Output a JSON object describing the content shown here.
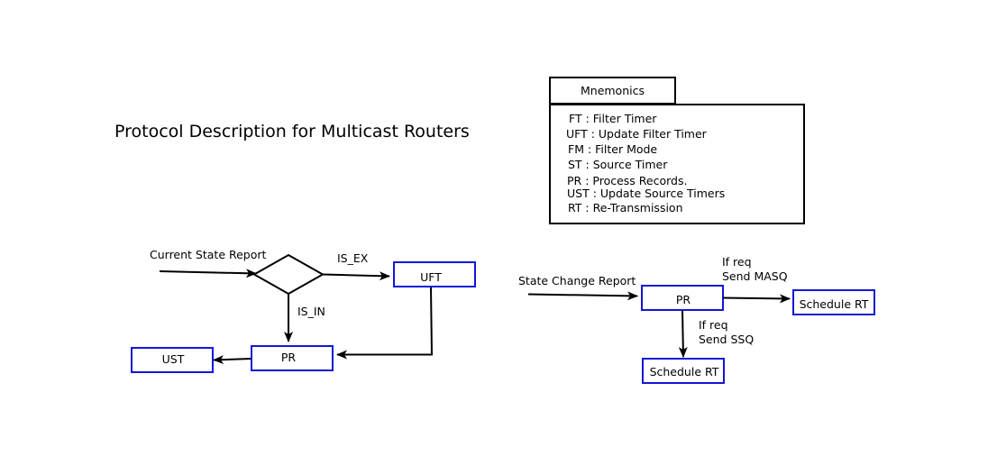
{
  "title": "Protocol Description for Multicast Routers",
  "mnemonics": {
    "header": "Mnemonics",
    "items": [
      "FT : Filter Timer",
      "UFT : Update Filter Timer",
      "FM : Filter Mode",
      "ST : Source Timer",
      "PR : Process Records.",
      "UST : Update Source Timers",
      "RT : Re-Transmission"
    ]
  },
  "current_state_flow": {
    "input_label": "Current State Report",
    "decision_exclude_label": "IS_EX",
    "decision_include_label": "IS_IN",
    "nodes": {
      "uft": "UFT",
      "pr": "PR",
      "ust": "UST"
    }
  },
  "state_change_flow": {
    "input_label": "State Change Report",
    "nodes": {
      "pr": "PR",
      "schedule_rt_right": "Schedule RT",
      "schedule_rt_bottom": "Schedule RT"
    },
    "masq_label_line1": "If req",
    "masq_label_line2": "Send MASQ",
    "ssq_label_line1": "If req",
    "ssq_label_line2": "Send SSQ"
  },
  "colors": {
    "process_box_border": "#1515d8",
    "line": "#000000"
  }
}
